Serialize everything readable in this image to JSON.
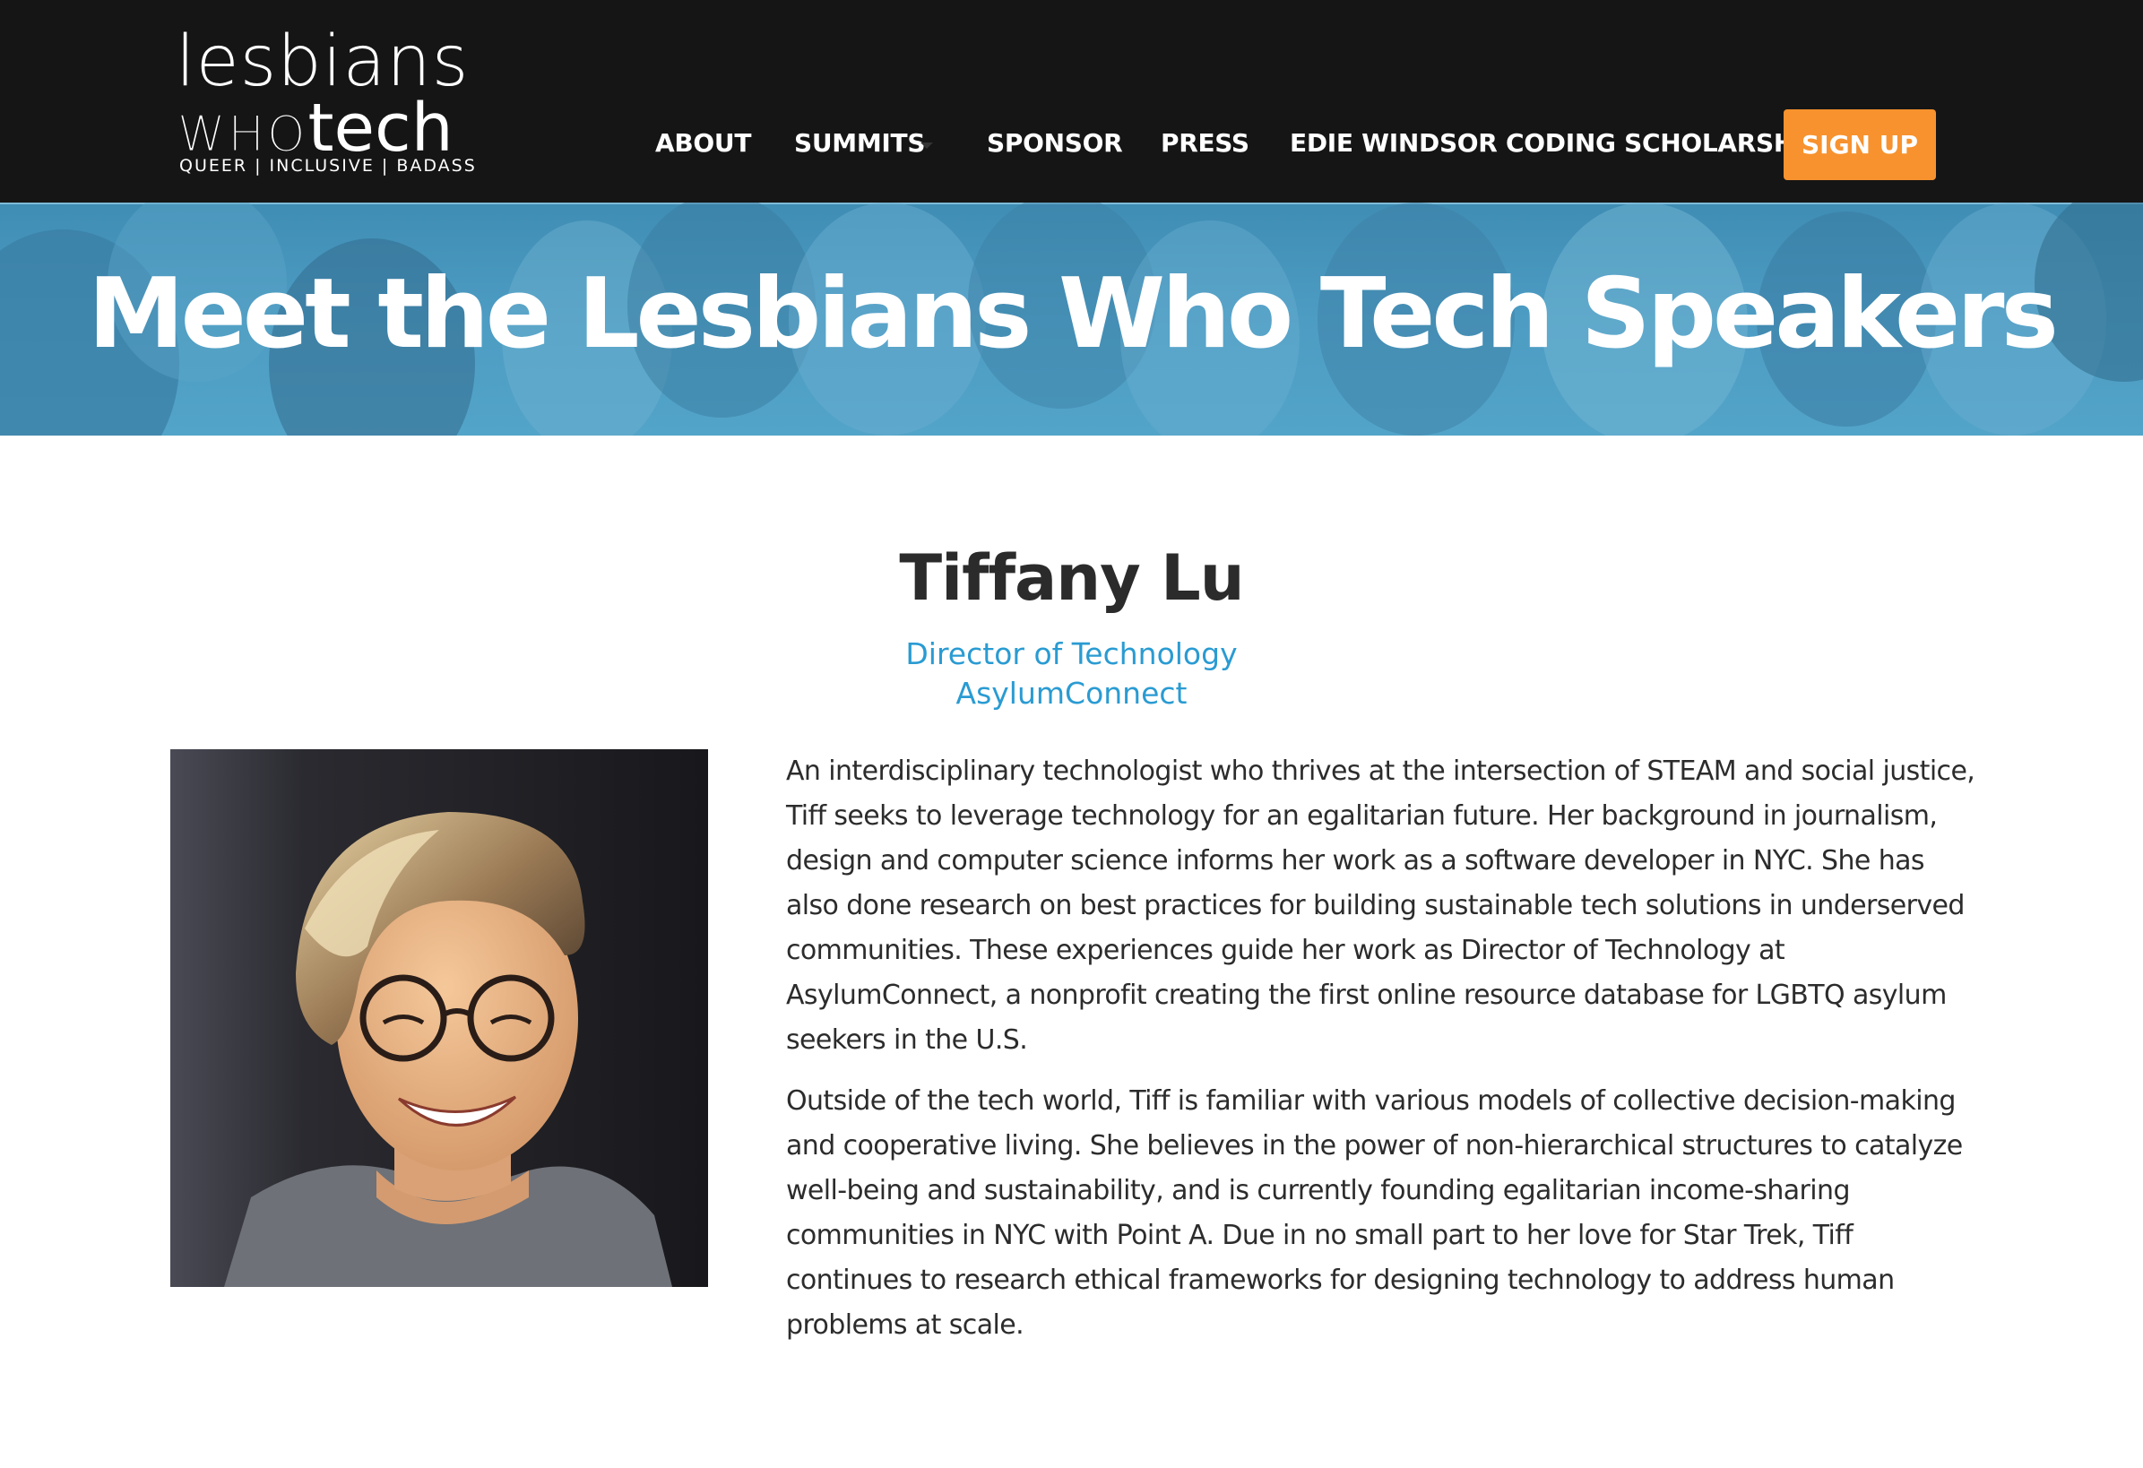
{
  "header": {
    "logo": {
      "line1": "lesbians",
      "who": "WHO",
      "tech": "tech",
      "tagline": "QUEER | INCLUSIVE | BADASS"
    },
    "nav": [
      {
        "label": "ABOUT"
      },
      {
        "label": "SUMMITS"
      },
      {
        "label": "SPONSOR"
      },
      {
        "label": "PRESS"
      },
      {
        "label": "EDIE WINDSOR CODING SCHOLARSHIP"
      }
    ],
    "signup_label": "SIGN UP",
    "colors": {
      "background": "#151515",
      "accent": "#f7922e"
    }
  },
  "hero": {
    "title": "Meet the Lesbians Who Tech Speakers",
    "color": "#4d9cc3"
  },
  "speaker": {
    "name": "Tiffany Lu",
    "title": "Director of Technology",
    "organization": "AsylumConnect",
    "link_color": "#2a9bd2",
    "bio": [
      "An interdisciplinary technologist who thrives at the intersection of STEAM and social justice, Tiff seeks to leverage technology for an egalitarian future. Her background in journalism, design and computer science informs her work as a software developer in NYC. She has also done research on best practices for building sustainable tech solutions in underserved communities. These experiences guide her work as Director of Technology at AsylumConnect, a nonprofit creating the first online resource database for LGBTQ asylum seekers in the U.S.",
      "Outside of the tech world, Tiff is familiar with various models of collective decision-making and cooperative living. She believes in the power of non-hierarchical structures to catalyze well-being and sustainability, and is currently founding egalitarian income-sharing communities in NYC with Point A. Due in no small part to her love for Star Trek, Tiff continues to research ethical frameworks for designing technology to address human problems at scale."
    ]
  }
}
